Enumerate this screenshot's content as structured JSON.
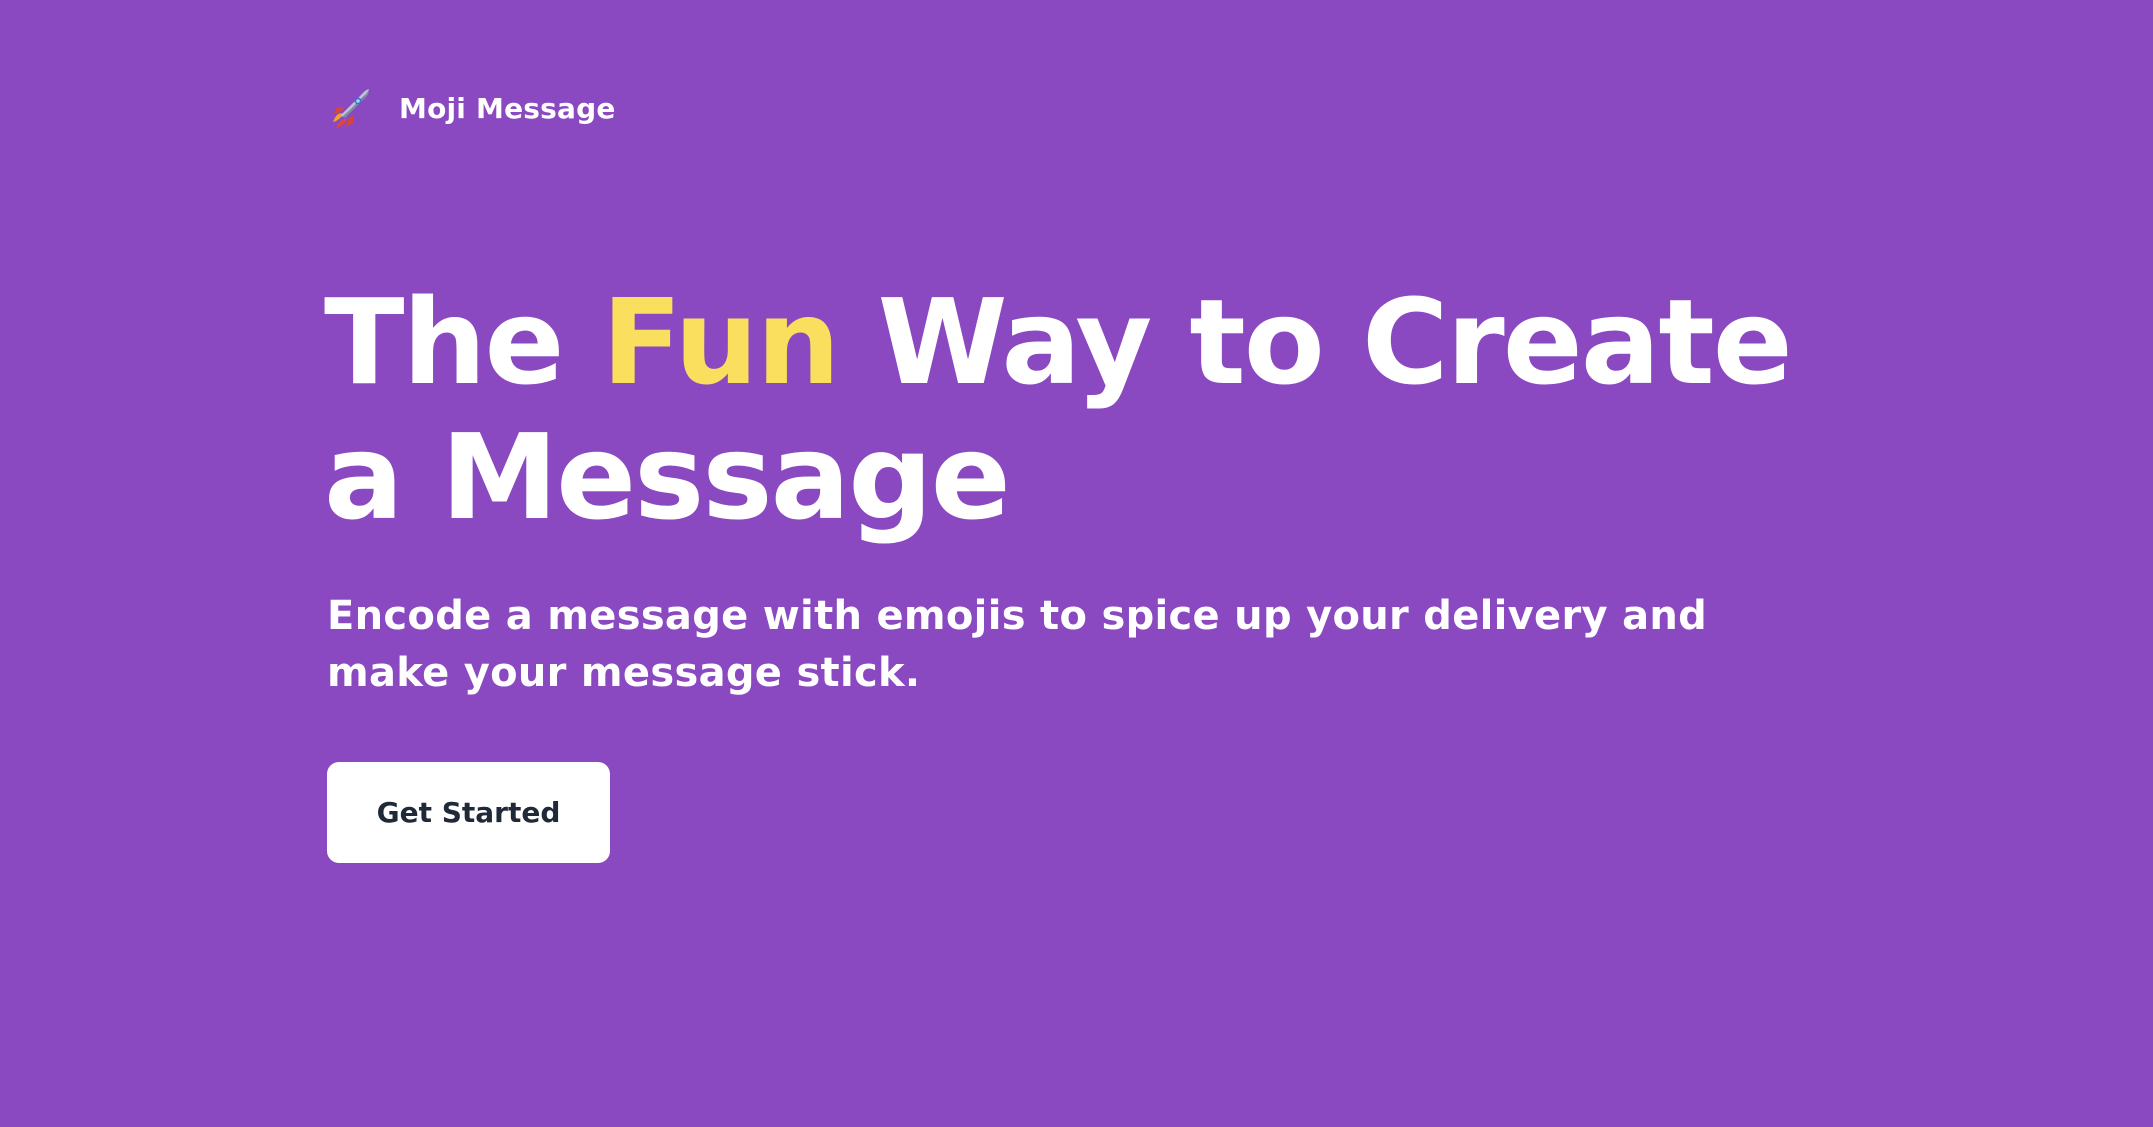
{
  "colors": {
    "background": "#8a48c1",
    "accent": "#f9df5d",
    "text": "#ffffff",
    "button_bg": "#ffffff",
    "button_text": "#1f2937"
  },
  "header": {
    "logo_icon": "rocket-icon",
    "app_name": "Moji Message"
  },
  "hero": {
    "title_part1": "The ",
    "title_highlight": "Fun",
    "title_part2": " Way to Create a Message",
    "subtitle": "Encode a message with emojis to spice up your delivery and make your message stick.",
    "cta_label": "Get Started"
  }
}
